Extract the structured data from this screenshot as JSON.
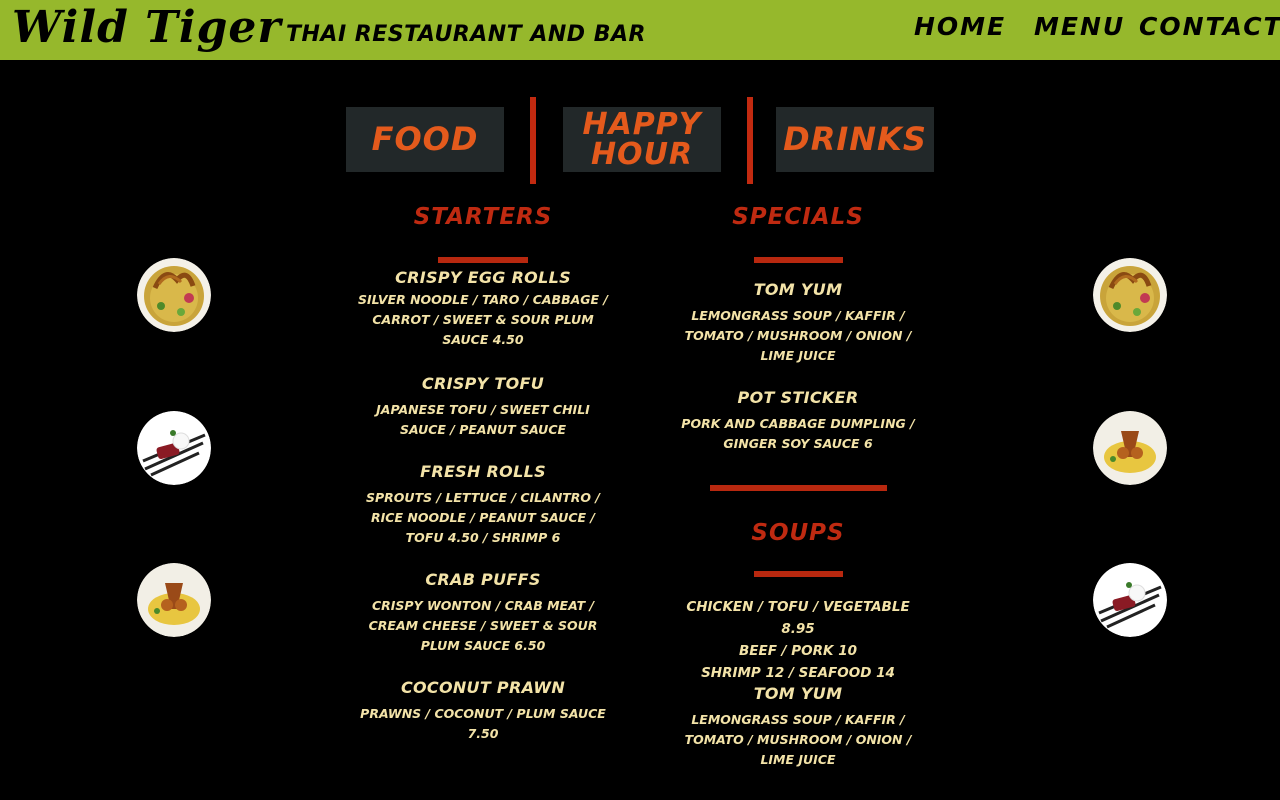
{
  "header": {
    "logo": "Wild Tiger",
    "tagline": "THAI RESTAURANT AND BAR",
    "nav": [
      "HOME",
      "MENU",
      "CONTACT"
    ],
    "colors": {
      "bar": "#96b82c",
      "text": "#000000"
    }
  },
  "tabs": {
    "food": "FOOD",
    "happy_hour_line1": "HAPPY",
    "happy_hour_line2": "HOUR",
    "drinks": "DRINKS"
  },
  "colors": {
    "accent_red": "#bf2a11",
    "tab_text": "#e45a1c",
    "tab_bg": "#222829",
    "menu_text": "#f3e3a8"
  },
  "starters": {
    "title": "STARTERS",
    "items": [
      {
        "name": "CRISPY EGG ROLLS",
        "desc": "SILVER NOODLE / TARO / CABBAGE / CARROT / SWEET & SOUR PLUM SAUCE 4.50"
      },
      {
        "name": "CRISPY TOFU",
        "desc": "JAPANESE TOFU / SWEET CHILI SAUCE / PEANUT SAUCE"
      },
      {
        "name": "FRESH ROLLS",
        "desc": "SPROUTS / LETTUCE / CILANTRO / RICE NOODLE / PEANUT SAUCE / TOFU 4.50 / SHRIMP 6"
      },
      {
        "name": "CRAB PUFFS",
        "desc": "CRISPY WONTON / CRAB MEAT / CREAM CHEESE / SWEET & SOUR PLUM SAUCE 6.50"
      },
      {
        "name": "COCONUT PRAWN",
        "desc": "PRAWNS / COCONUT / PLUM SAUCE 7.50"
      }
    ]
  },
  "specials": {
    "title": "SPECIALS",
    "items": [
      {
        "name": "TOM YUM",
        "desc": "LEMONGRASS SOUP / KAFFIR / TOMATO / MUSHROOM / ONION / LIME JUICE"
      },
      {
        "name": "POT STICKER",
        "desc": "PORK AND CABBAGE DUMPLING / GINGER SOY SAUCE 6"
      }
    ]
  },
  "soups": {
    "title": "SOUPS",
    "prices": [
      "CHICKEN / TOFU / VEGETABLE 8.95",
      "BEEF / PORK 10",
      "SHRIMP 12 / SEAFOOD 14"
    ],
    "items": [
      {
        "name": "TOM YUM",
        "desc": "LEMONGRASS SOUP / KAFFIR / TOMATO / MUSHROOM / ONION / LIME JUICE"
      }
    ]
  },
  "photos": {
    "left": [
      "noodle-soup-bowl-icon",
      "dessert-plate-icon",
      "roast-duck-curry-icon"
    ],
    "right": [
      "noodle-soup-bowl-icon",
      "roast-duck-curry-icon",
      "dessert-plate-icon"
    ]
  }
}
